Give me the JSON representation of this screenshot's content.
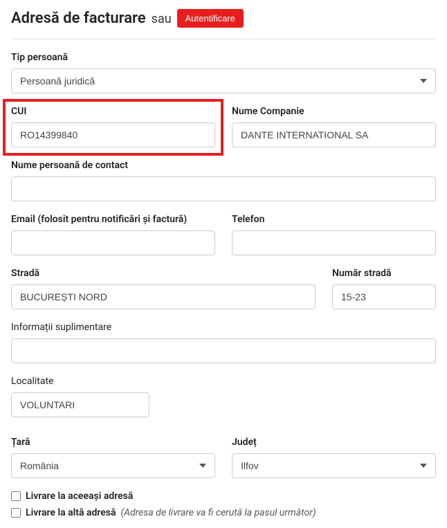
{
  "header": {
    "title": "Adresă de facturare",
    "sau": "sau",
    "auth_button": "Autentificare"
  },
  "fields": {
    "tip_persoana": {
      "label": "Tip persoană",
      "value": "Persoană juridică"
    },
    "cui": {
      "label": "CUI",
      "value": "RO14399840"
    },
    "nume_companie": {
      "label": "Nume Companie",
      "value": "DANTE INTERNATIONAL SA"
    },
    "contact": {
      "label": "Nume persoană de contact",
      "value": ""
    },
    "email": {
      "label": "Email (folosit pentru notificări și factură)",
      "value": ""
    },
    "telefon": {
      "label": "Telefon",
      "value": ""
    },
    "strada": {
      "label": "Stradă",
      "value": "BUCUREȘTI NORD"
    },
    "numar": {
      "label": "Număr stradă",
      "value": "15-23"
    },
    "info": {
      "label": "Informații suplimentare",
      "value": ""
    },
    "localitate": {
      "label": "Localitate",
      "value": "VOLUNTARI"
    },
    "tara": {
      "label": "Țară",
      "value": "România"
    },
    "judet": {
      "label": "Județ",
      "value": "Ilfov"
    }
  },
  "checkboxes": {
    "same": {
      "label": "Livrare la aceeași adresă"
    },
    "other": {
      "label": "Livrare la altă adresă",
      "hint": "(Adresa de livrare va fi cerută la pasul următor)"
    }
  }
}
